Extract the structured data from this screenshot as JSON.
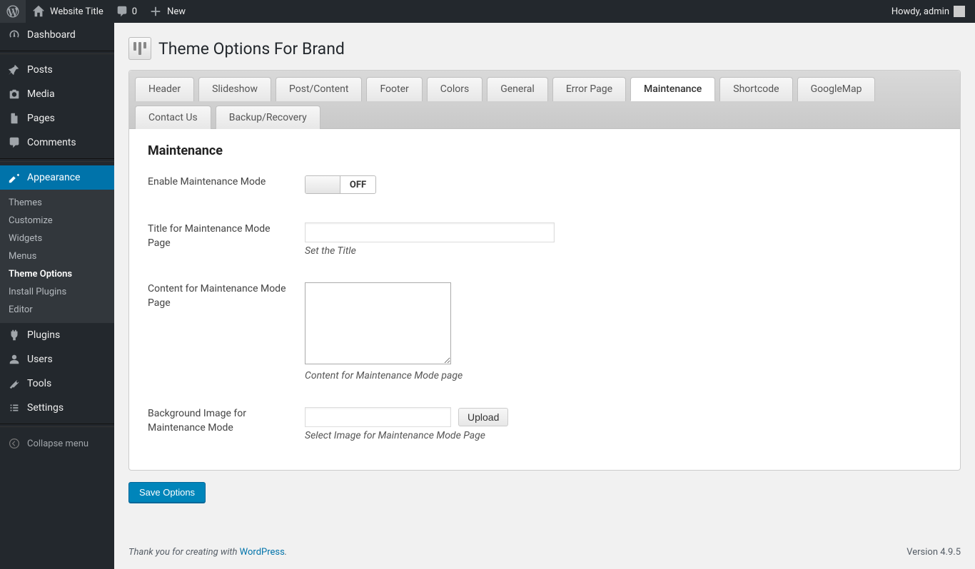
{
  "adminbar": {
    "site_title": "Website Title",
    "comment_count": "0",
    "new_label": "New",
    "howdy": "Howdy, admin"
  },
  "sidebar": {
    "items": [
      {
        "id": "dashboard",
        "label": "Dashboard"
      },
      {
        "id": "posts",
        "label": "Posts"
      },
      {
        "id": "media",
        "label": "Media"
      },
      {
        "id": "pages",
        "label": "Pages"
      },
      {
        "id": "comments",
        "label": "Comments"
      },
      {
        "id": "appearance",
        "label": "Appearance"
      },
      {
        "id": "plugins",
        "label": "Plugins"
      },
      {
        "id": "users",
        "label": "Users"
      },
      {
        "id": "tools",
        "label": "Tools"
      },
      {
        "id": "settings",
        "label": "Settings"
      }
    ],
    "appearance_sub": [
      "Themes",
      "Customize",
      "Widgets",
      "Menus",
      "Theme Options",
      "Install Plugins",
      "Editor"
    ],
    "collapse_label": "Collapse menu"
  },
  "page": {
    "title": "Theme Options For Brand"
  },
  "tabs": [
    "Header",
    "Slideshow",
    "Post/Content",
    "Footer",
    "Colors",
    "General",
    "Error Page",
    "Maintenance",
    "Shortcode",
    "GoogleMap",
    "Contact Us",
    "Backup/Recovery"
  ],
  "active_tab": "Maintenance",
  "section": {
    "heading": "Maintenance",
    "enable_label": "Enable Maintenance Mode",
    "toggle_state": "OFF",
    "title_label": "Title for Maintenance Mode Page",
    "title_value": "",
    "title_help": "Set the Title",
    "content_label": "Content for Maintenance Mode Page",
    "content_value": "",
    "content_help": "Content for Maintenance Mode page",
    "bg_label": "Background Image for Maintenance Mode",
    "bg_value": "",
    "bg_help": "Select Image for Maintenance Mode Page",
    "upload_btn": "Upload"
  },
  "save_label": "Save Options",
  "footer": {
    "thankyou_prefix": "Thank you for creating with ",
    "wordpress_link": "WordPress",
    "thankyou_suffix": ".",
    "version": "Version 4.9.5"
  }
}
